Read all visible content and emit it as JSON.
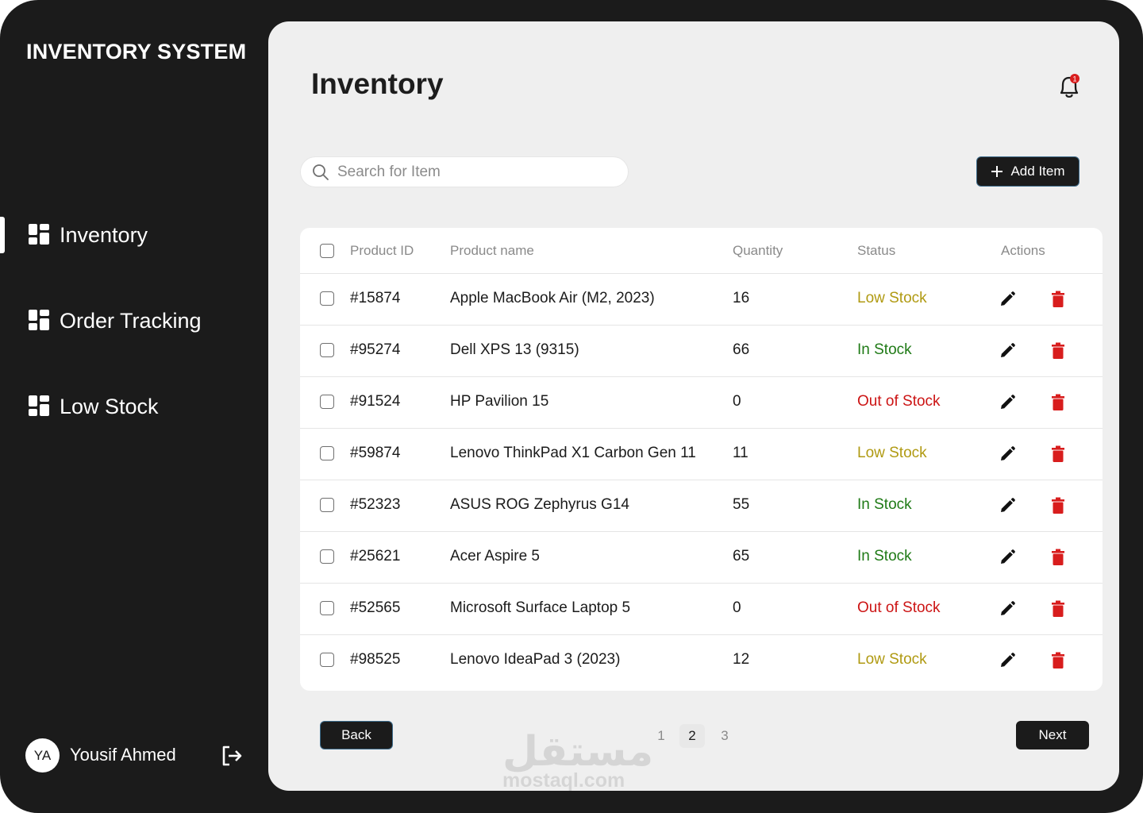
{
  "sidebar": {
    "brand": "INVENTORY SYSTEM",
    "items": [
      {
        "label": "Inventory",
        "active": true
      },
      {
        "label": "Order Tracking",
        "active": false
      },
      {
        "label": "Low Stock",
        "active": false
      }
    ],
    "user": {
      "initials": "YA",
      "name": "Yousif Ahmed"
    }
  },
  "main": {
    "title": "Inventory",
    "notifications": {
      "count": "1"
    },
    "search": {
      "placeholder": "Search for Item",
      "value": ""
    },
    "add_button": "Add Item"
  },
  "table": {
    "columns": [
      "Product ID",
      "Product name",
      "Quantity",
      "Status",
      "Actions"
    ],
    "rows": [
      {
        "id": "#15874",
        "name": "Apple MacBook Air (M2, 2023)",
        "qty": "16",
        "status": "Low Stock"
      },
      {
        "id": "#95274",
        "name": "Dell XPS 13 (9315)",
        "qty": "66",
        "status": "In Stock"
      },
      {
        "id": "#91524",
        "name": "HP Pavilion 15",
        "qty": "0",
        "status": "Out of Stock"
      },
      {
        "id": "#59874",
        "name": "Lenovo ThinkPad X1 Carbon Gen 11",
        "qty": "11",
        "status": "Low Stock"
      },
      {
        "id": "#52323",
        "name": "ASUS ROG Zephyrus G14",
        "qty": "55",
        "status": "In Stock"
      },
      {
        "id": "#25621",
        "name": "Acer Aspire 5",
        "qty": "65",
        "status": "In Stock"
      },
      {
        "id": "#52565",
        "name": "Microsoft Surface Laptop 5",
        "qty": "0",
        "status": "Out of Stock"
      },
      {
        "id": "#98525",
        "name": "Lenovo IdeaPad 3 (2023)",
        "qty": "12",
        "status": "Low Stock"
      }
    ],
    "status_colors": {
      "Low Stock": "#b09a12",
      "In Stock": "#1f7a16",
      "Out of Stock": "#cc1414"
    },
    "delete_color": "#d81d1d"
  },
  "pagination": {
    "back": "Back",
    "next": "Next",
    "pages": [
      "1",
      "2",
      "3"
    ],
    "current": "2"
  },
  "watermark": {
    "arabic": "مستقل",
    "latin": "mostaql.com"
  }
}
